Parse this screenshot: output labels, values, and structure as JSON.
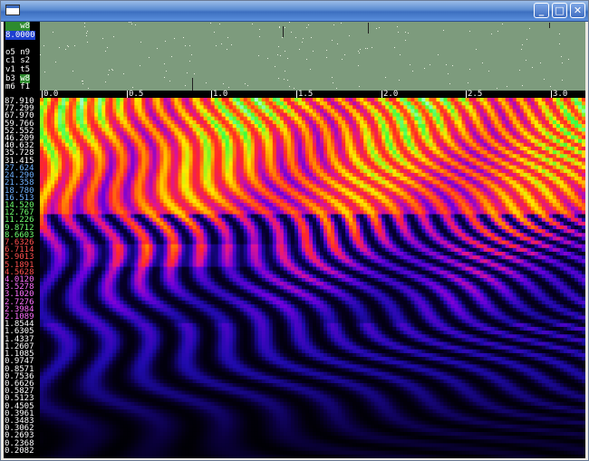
{
  "window": {
    "title": "",
    "buttons": {
      "minimize": "_",
      "maximize": "□",
      "close": "✕"
    },
    "icons": {
      "app": "window-app-icon",
      "minimize": "minimize-icon",
      "maximize": "maximize-icon",
      "close": "close-icon"
    }
  },
  "controls": [
    {
      "text": "   w8",
      "highlight": "green"
    },
    {
      "text": "8.0000",
      "highlight": "blue"
    },
    {
      "text": "",
      "highlight": ""
    },
    {
      "text": "o5 n9",
      "highlight": ""
    },
    {
      "text": "c1 s2",
      "highlight": ""
    },
    {
      "text": "v1 t5",
      "highlight": ""
    },
    {
      "text": "b3 ",
      "highlight": "",
      "tail": "w8",
      "tail_highlight": "green"
    },
    {
      "text": "m6 f1",
      "highlight": ""
    }
  ],
  "time_axis": {
    "labels": [
      "0.0",
      "0.5",
      "1.0",
      "1.5",
      "2.0",
      "2.5",
      "3.0"
    ],
    "values": [
      0.0,
      0.5,
      1.0,
      1.5,
      2.0,
      2.5,
      3.0
    ],
    "max": 3.15
  },
  "frequency_labels": [
    {
      "text": "87.910",
      "color": "#ffffff"
    },
    {
      "text": "77.299",
      "color": "#ffffff"
    },
    {
      "text": "67.970",
      "color": "#ffffff"
    },
    {
      "text": "59.766",
      "color": "#ffffff"
    },
    {
      "text": "52.552",
      "color": "#ffffff"
    },
    {
      "text": "46.209",
      "color": "#ffffff"
    },
    {
      "text": "40.632",
      "color": "#ffffff"
    },
    {
      "text": "35.728",
      "color": "#ffffff"
    },
    {
      "text": "31.415",
      "color": "#ffffff"
    },
    {
      "text": "27.624",
      "color": "#6fb1ff"
    },
    {
      "text": "24.290",
      "color": "#6fb1ff"
    },
    {
      "text": "21.358",
      "color": "#6fb1ff"
    },
    {
      "text": "18.780",
      "color": "#6fb1ff"
    },
    {
      "text": "16.513",
      "color": "#6fb1ff"
    },
    {
      "text": "14.520",
      "color": "#6fff6f"
    },
    {
      "text": "12.767",
      "color": "#6fff6f"
    },
    {
      "text": "11.226",
      "color": "#6fff6f"
    },
    {
      "text": "9.8712",
      "color": "#6fff6f"
    },
    {
      "text": "8.6603",
      "color": "#6fff6f"
    },
    {
      "text": "7.6326",
      "color": "#ff4f4f"
    },
    {
      "text": "6.7114",
      "color": "#ff4f4f"
    },
    {
      "text": "5.9013",
      "color": "#ff4f4f"
    },
    {
      "text": "5.1891",
      "color": "#ff4f4f"
    },
    {
      "text": "4.5628",
      "color": "#ff4f4f"
    },
    {
      "text": "4.0120",
      "color": "#ff6fff"
    },
    {
      "text": "3.5278",
      "color": "#ff6fff"
    },
    {
      "text": "3.1020",
      "color": "#ff6fff"
    },
    {
      "text": "2.7276",
      "color": "#ff6fff"
    },
    {
      "text": "2.3984",
      "color": "#ff6fff"
    },
    {
      "text": "2.1089",
      "color": "#ff6fff"
    },
    {
      "text": "1.8544",
      "color": "#ffffff"
    },
    {
      "text": "1.6305",
      "color": "#ffffff"
    },
    {
      "text": "1.4337",
      "color": "#ffffff"
    },
    {
      "text": "1.2607",
      "color": "#ffffff"
    },
    {
      "text": "1.1085",
      "color": "#ffffff"
    },
    {
      "text": "0.9747",
      "color": "#ffffff"
    },
    {
      "text": "0.8571",
      "color": "#ffffff"
    },
    {
      "text": "0.7536",
      "color": "#ffffff"
    },
    {
      "text": "0.6626",
      "color": "#ffffff"
    },
    {
      "text": "0.5827",
      "color": "#ffffff"
    },
    {
      "text": "0.5123",
      "color": "#ffffff"
    },
    {
      "text": "0.4505",
      "color": "#ffffff"
    },
    {
      "text": "0.3961",
      "color": "#ffffff"
    },
    {
      "text": "0.3483",
      "color": "#ffffff"
    },
    {
      "text": "0.3062",
      "color": "#ffffff"
    },
    {
      "text": "0.2693",
      "color": "#ffffff"
    },
    {
      "text": "0.2368",
      "color": "#ffffff"
    },
    {
      "text": "0.2082",
      "color": "#ffffff"
    }
  ],
  "colors": {
    "waveform_background": "#7d9b7d",
    "scalogram_background": "#000000",
    "titlebar": "#3d6fc0"
  }
}
